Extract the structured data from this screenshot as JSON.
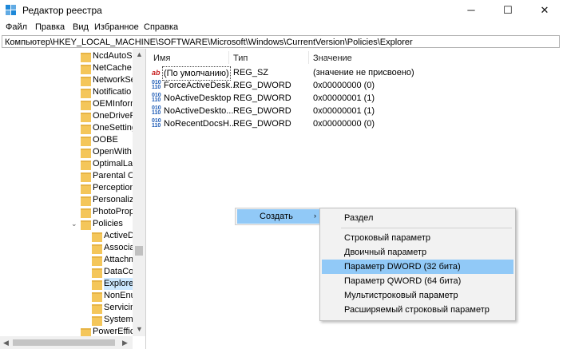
{
  "window": {
    "title": "Редактор реестра",
    "minimize_icon": "─",
    "maximize_icon": "☐",
    "close_icon": "✕"
  },
  "menu": [
    "Файл",
    "Правка",
    "Вид",
    "Избранное",
    "Справка"
  ],
  "address": "Компьютер\\HKEY_LOCAL_MACHINE\\SOFTWARE\\Microsoft\\Windows\\CurrentVersion\\Policies\\Explorer",
  "tree": [
    {
      "label": "NcdAutoSe",
      "level": 1
    },
    {
      "label": "NetCache",
      "level": 1
    },
    {
      "label": "NetworkSe",
      "level": 1
    },
    {
      "label": "Notificatio",
      "level": 1
    },
    {
      "label": "OEMInform",
      "level": 1
    },
    {
      "label": "OneDriveRa",
      "level": 1
    },
    {
      "label": "OneSetting",
      "level": 1
    },
    {
      "label": "OOBE",
      "level": 1
    },
    {
      "label": "OpenWith",
      "level": 1
    },
    {
      "label": "OptimalLay",
      "level": 1
    },
    {
      "label": "Parental Co",
      "level": 1
    },
    {
      "label": "PerceptionS",
      "level": 1
    },
    {
      "label": "Personaliza",
      "level": 1
    },
    {
      "label": "PhotoPropo",
      "level": 1
    },
    {
      "label": "Policies",
      "level": 1,
      "expanded": true
    },
    {
      "label": "ActiveDe",
      "level": 2
    },
    {
      "label": "Associat",
      "level": 2
    },
    {
      "label": "Attachm",
      "level": 2
    },
    {
      "label": "DataColl",
      "level": 2
    },
    {
      "label": "Explorer",
      "level": 2,
      "selected": true
    },
    {
      "label": "NonEnu",
      "level": 2
    },
    {
      "label": "Servicing",
      "level": 2
    },
    {
      "label": "System",
      "level": 2
    },
    {
      "label": "PowerEffici",
      "level": 1
    }
  ],
  "columns": {
    "name": "Имя",
    "type": "Тип",
    "value": "Значение"
  },
  "values": [
    {
      "icon": "ab",
      "name": "(По умолчанию)",
      "type": "REG_SZ",
      "value": "(значение не присвоено)"
    },
    {
      "icon": "bin",
      "name": "ForceActiveDesk...",
      "type": "REG_DWORD",
      "value": "0x00000000 (0)"
    },
    {
      "icon": "bin",
      "name": "NoActiveDesktop",
      "type": "REG_DWORD",
      "value": "0x00000001 (1)"
    },
    {
      "icon": "bin",
      "name": "NoActiveDeskto...",
      "type": "REG_DWORD",
      "value": "0x00000001 (1)"
    },
    {
      "icon": "bin",
      "name": "NoRecentDocsH...",
      "type": "REG_DWORD",
      "value": "0x00000000 (0)"
    }
  ],
  "context_menu": {
    "label": "Создать",
    "arrow": "›"
  },
  "submenu": {
    "items": [
      "Раздел",
      "Строковый параметр",
      "Двоичный параметр",
      "Параметр DWORD (32 бита)",
      "Параметр QWORD (64 бита)",
      "Мультистроковый параметр",
      "Расширяемый строковый параметр"
    ],
    "highlighted_index": 3
  },
  "colors": {
    "highlight": "#91c9f7",
    "selection": "#cce8ff",
    "folder": "#f4c65a"
  }
}
